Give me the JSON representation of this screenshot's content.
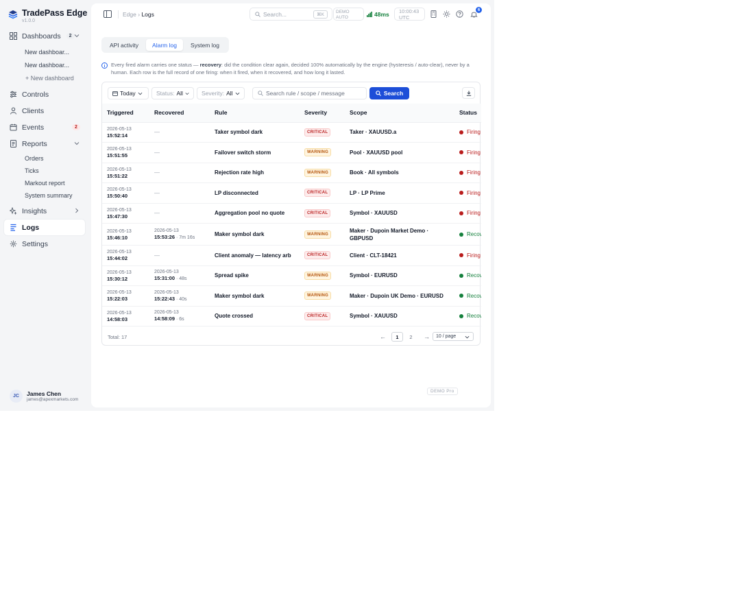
{
  "brand": {
    "name": "TradePass Edge",
    "version": "v1.0.0"
  },
  "sidebar": {
    "dashboards": {
      "label": "Dashboards",
      "count": "2",
      "items": [
        "New dashboar...",
        "New dashboar..."
      ],
      "add": "+ New dashboard"
    },
    "controls": "Controls",
    "clients": "Clients",
    "events": {
      "label": "Events",
      "count": "2"
    },
    "reports": {
      "label": "Reports",
      "items": [
        "Orders",
        "Ticks",
        "Markout report",
        "System summary"
      ]
    },
    "insights": "Insights",
    "logs": "Logs",
    "settings": "Settings"
  },
  "user": {
    "initials": "JC",
    "name": "James Chen",
    "email": "james@apexmarkets.com"
  },
  "topbar": {
    "crumb_parent": "Edge",
    "crumb_sep": "›",
    "crumb_current": "Logs",
    "search_placeholder": "Search...",
    "search_kbd": "⌘K",
    "mode_line1": "DEMO",
    "mode_line2": "AUTO",
    "latency": "48ms",
    "time_line1": "10:00:43",
    "time_line2": "UTC",
    "notifications": "6"
  },
  "tabs": [
    "API activity",
    "Alarm log",
    "System log"
  ],
  "info": {
    "pre": "Every fired alarm carries one status — ",
    "bold": "recovery",
    "post": ": did the condition clear again, decided 100% automatically by the engine (hysteresis / auto-clear), never by a human. Each row is the full record of one firing: when it fired, when it recovered, and how long it lasted."
  },
  "filters": {
    "range": "Today",
    "status_label": "Status:",
    "status_value": "All",
    "severity_label": "Severity:",
    "severity_value": "All",
    "search_placeholder": "Search rule / scope / message",
    "search_button": "Search"
  },
  "table": {
    "columns": [
      "Triggered",
      "Recovered",
      "Rule",
      "Severity",
      "Scope",
      "Status"
    ],
    "rows": [
      {
        "t_date": "2026-05-13",
        "t_time": "15:52:14",
        "r_date": "",
        "r_time": "",
        "r_dur": "",
        "rule": "Taker symbol dark",
        "severity": "CRITICAL",
        "scope": "Taker · XAUUSD.a",
        "status": "Firing"
      },
      {
        "t_date": "2026-05-13",
        "t_time": "15:51:55",
        "r_date": "",
        "r_time": "",
        "r_dur": "",
        "rule": "Failover switch storm",
        "severity": "WARNING",
        "scope": "Pool · XAUUSD pool",
        "status": "Firing"
      },
      {
        "t_date": "2026-05-13",
        "t_time": "15:51:22",
        "r_date": "",
        "r_time": "",
        "r_dur": "",
        "rule": "Rejection rate high",
        "severity": "WARNING",
        "scope": "Book · All symbols",
        "status": "Firing"
      },
      {
        "t_date": "2026-05-13",
        "t_time": "15:50:40",
        "r_date": "",
        "r_time": "",
        "r_dur": "",
        "rule": "LP disconnected",
        "severity": "CRITICAL",
        "scope": "LP · LP Prime",
        "status": "Firing"
      },
      {
        "t_date": "2026-05-13",
        "t_time": "15:47:30",
        "r_date": "",
        "r_time": "",
        "r_dur": "",
        "rule": "Aggregation pool no quote",
        "severity": "CRITICAL",
        "scope": "Symbol · XAUUSD",
        "status": "Firing"
      },
      {
        "t_date": "2026-05-13",
        "t_time": "15:46:10",
        "r_date": "2026-05-13",
        "r_time": "15:53:26",
        "r_dur": " · 7m 16s",
        "rule": "Maker symbol dark",
        "severity": "WARNING",
        "scope": "Maker · Dupoin Market Demo · GBPUSD",
        "status": "Recovered"
      },
      {
        "t_date": "2026-05-13",
        "t_time": "15:44:02",
        "r_date": "",
        "r_time": "",
        "r_dur": "",
        "rule": "Client anomaly — latency arb",
        "severity": "CRITICAL",
        "scope": "Client · CLT-18421",
        "status": "Firing"
      },
      {
        "t_date": "2026-05-13",
        "t_time": "15:30:12",
        "r_date": "2026-05-13",
        "r_time": "15:31:00",
        "r_dur": " · 48s",
        "rule": "Spread spike",
        "severity": "WARNING",
        "scope": "Symbol · EURUSD",
        "status": "Recovered"
      },
      {
        "t_date": "2026-05-13",
        "t_time": "15:22:03",
        "r_date": "2026-05-13",
        "r_time": "15:22:43",
        "r_dur": " · 40s",
        "rule": "Maker symbol dark",
        "severity": "WARNING",
        "scope": "Maker · Dupoin UK Demo · EURUSD",
        "status": "Recovered"
      },
      {
        "t_date": "2026-05-13",
        "t_time": "14:58:03",
        "r_date": "2026-05-13",
        "r_time": "14:58:09",
        "r_dur": " · 6s",
        "rule": "Quote crossed",
        "severity": "CRITICAL",
        "scope": "Symbol · XAUUSD",
        "status": "Recovered"
      }
    ],
    "empty": "—"
  },
  "pager": {
    "total": "Total: 17",
    "prev": "←",
    "pages": [
      "1",
      "2"
    ],
    "next": "→",
    "per_page": "10 / page"
  },
  "footer_badge": "DEMO Pro",
  "colors": {
    "accent": "#2563eb",
    "firing": "#b91c1c",
    "recovered": "#15803d",
    "critical": "#b91c1c",
    "warning": "#b45309"
  }
}
